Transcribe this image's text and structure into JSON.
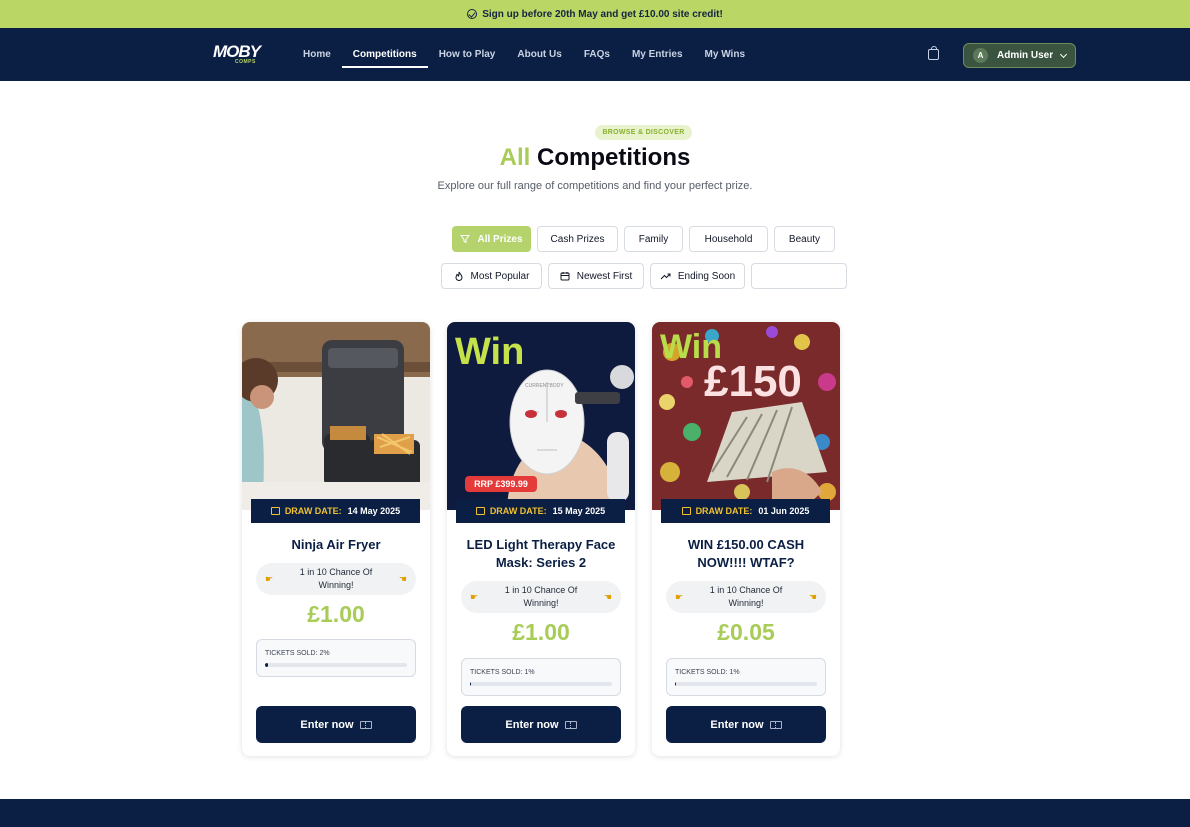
{
  "promo": {
    "text": "Sign up before 20th May and get £10.00 site credit!"
  },
  "logo": {
    "main": "MOBY",
    "sub": "COMPS"
  },
  "nav": {
    "links": [
      "Home",
      "Competitions",
      "How to Play",
      "About Us",
      "FAQs",
      "My Entries",
      "My Wins"
    ],
    "active": "Competitions",
    "user": {
      "initial": "A",
      "name": "Admin User"
    }
  },
  "hero": {
    "badge": "BROWSE & DISCOVER",
    "title_accent": "All",
    "title_rest": "Competitions",
    "subtitle": "Explore our full range of competitions and find your perfect prize."
  },
  "filters": {
    "categories": [
      "All Prizes",
      "Cash Prizes",
      "Family",
      "Household",
      "Beauty"
    ],
    "active_category": "All Prizes",
    "sorts": [
      "Most Popular",
      "Newest First",
      "Ending Soon"
    ],
    "search_value": ""
  },
  "cards": [
    {
      "image_text": "",
      "draw_label": "DRAW DATE:",
      "draw_date": "14 May 2025",
      "title": "Ninja Air Fryer",
      "chance": "1 in 10 Chance Of Winning!",
      "price": "£1.00",
      "sold_label": "TICKETS SOLD: 2%",
      "sold_percent": 2,
      "button": "Enter now"
    },
    {
      "image_text": "Win",
      "image_badge": "RRP £399.99",
      "image_brand": "CURRENTBODY",
      "draw_label": "DRAW DATE:",
      "draw_date": "15 May 2025",
      "title": "LED Light Therapy Face Mask: Series 2",
      "chance": "1 in 10 Chance Of Winning!",
      "price": "£1.00",
      "sold_label": "TICKETS SOLD: 1%",
      "sold_percent": 1,
      "button": "Enter now"
    },
    {
      "image_text": "Win",
      "image_amount": "£150",
      "draw_label": "DRAW DATE:",
      "draw_date": "01 Jun 2025",
      "title": "WIN £150.00 CASH NOW!!!! WTAF?",
      "chance": "1 in 10 Chance Of Winning!",
      "price": "£0.05",
      "sold_label": "TICKETS SOLD: 1%",
      "sold_percent": 1,
      "button": "Enter now"
    }
  ],
  "colors": {
    "promo_bg": "#bad665",
    "nav_bg": "#0b1f44",
    "accent": "#a8cc58",
    "draw_label": "#f2c12e"
  }
}
